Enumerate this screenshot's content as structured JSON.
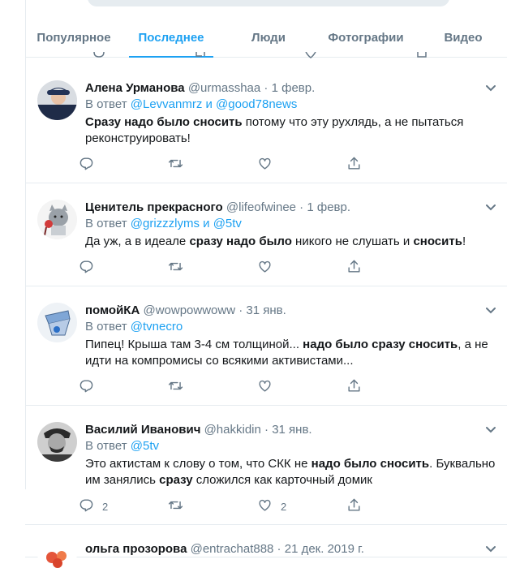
{
  "tabs": [
    {
      "label": "Популярное"
    },
    {
      "label": "Последнее"
    },
    {
      "label": "Люди"
    },
    {
      "label": "Фотографии"
    },
    {
      "label": "Видео"
    }
  ],
  "tweets": [
    {
      "name": "Алена Урманова",
      "handle": "@urmasshaa",
      "time": "1 февр.",
      "reply_prefix": "В ответ",
      "reply_to": "@Levvanmrz и @good78news",
      "text_parts": [
        {
          "t": "Сразу надо было сносить",
          "b": true
        },
        {
          "t": " потому что эту рухлядь, а не пытаться реконструировать!",
          "b": false
        }
      ],
      "reply_count": "",
      "retweet_count": "",
      "like_count": ""
    },
    {
      "name": "Ценитель прекрасного",
      "handle": "@lifeofwinee",
      "time": "1 февр.",
      "reply_prefix": "В ответ",
      "reply_to": "@grizzzlyms и @5tv",
      "text_parts": [
        {
          "t": "Да уж, а в идеале ",
          "b": false
        },
        {
          "t": "сразу надо было",
          "b": true
        },
        {
          "t": " никого не слушать и ",
          "b": false
        },
        {
          "t": "сносить",
          "b": true
        },
        {
          "t": "!",
          "b": false
        }
      ],
      "reply_count": "",
      "retweet_count": "",
      "like_count": ""
    },
    {
      "name": "помойКА",
      "handle": "@wowpowwoww",
      "time": "31 янв.",
      "reply_prefix": "В ответ",
      "reply_to": "@tvnecro",
      "text_parts": [
        {
          "t": "Пипец! Крыша там 3-4 см толщиной... ",
          "b": false
        },
        {
          "t": "надо было сразу сносить",
          "b": true
        },
        {
          "t": ", а не идти на компромисы со всякими активистами...",
          "b": false
        }
      ],
      "reply_count": "",
      "retweet_count": "",
      "like_count": ""
    },
    {
      "name": "Василий Иванович",
      "handle": "@hakkidin",
      "time": "31 янв.",
      "reply_prefix": "В ответ",
      "reply_to": "@5tv",
      "text_parts": [
        {
          "t": "Это актистам к слову о том, что СКК не ",
          "b": false
        },
        {
          "t": "надо было сносить",
          "b": true
        },
        {
          "t": ". Буквально им занялись ",
          "b": false
        },
        {
          "t": "сразу",
          "b": true
        },
        {
          "t": " сложился как карточный домик",
          "b": false
        }
      ],
      "reply_count": "2",
      "retweet_count": "",
      "like_count": "2"
    },
    {
      "name": "ольга прозорова",
      "handle": "@entrachat888",
      "time": "21 дек. 2019 г.",
      "reply_prefix": "",
      "reply_to": "",
      "text_parts": [],
      "reply_count": "",
      "retweet_count": "",
      "like_count": ""
    }
  ],
  "colors": {
    "accent": "#1da1f2",
    "muted": "#657786",
    "text": "#14171a",
    "border": "#e6ecf0"
  },
  "icons": {
    "reply": "reply-icon",
    "retweet": "retweet-icon",
    "like": "like-icon",
    "share": "share-icon",
    "caret": "chevron-down-icon"
  }
}
